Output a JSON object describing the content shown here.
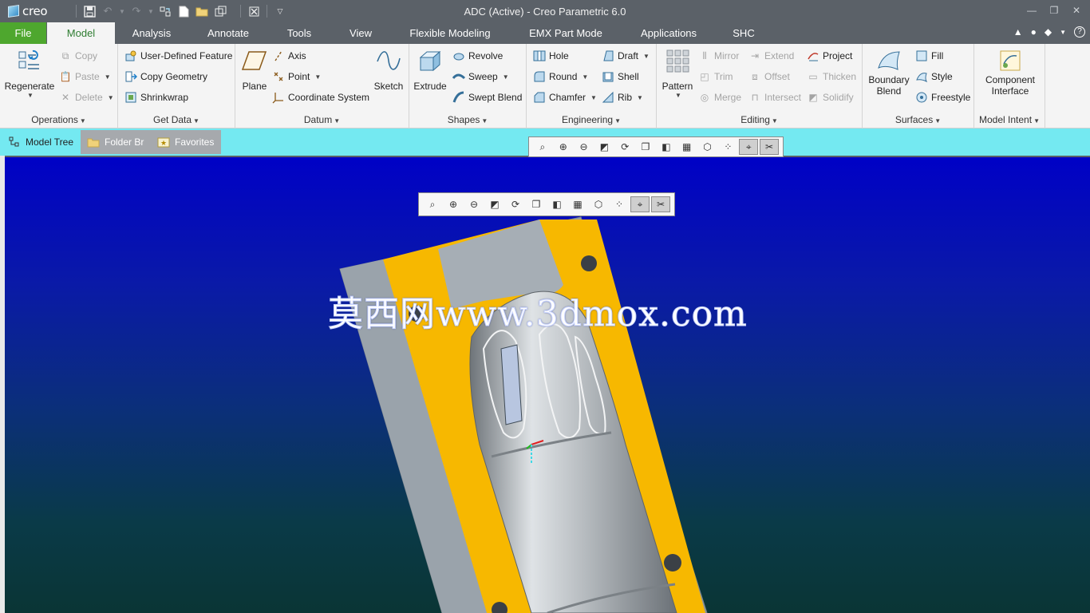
{
  "app": {
    "logo_text": "creo",
    "window_title": "ADC (Active) - Creo Parametric 6.0"
  },
  "tabs": [
    {
      "label": "File"
    },
    {
      "label": "Model"
    },
    {
      "label": "Analysis"
    },
    {
      "label": "Annotate"
    },
    {
      "label": "Tools"
    },
    {
      "label": "View"
    },
    {
      "label": "Flexible Modeling"
    },
    {
      "label": "EMX Part Mode"
    },
    {
      "label": "Applications"
    },
    {
      "label": "SHC"
    }
  ],
  "ribbon": {
    "operations": {
      "label": "Operations",
      "regenerate": "Regenerate",
      "copy": "Copy",
      "paste": "Paste",
      "delete": "Delete"
    },
    "get_data": {
      "label": "Get Data",
      "user_defined_feature": "User-Defined Feature",
      "copy_geometry": "Copy Geometry",
      "shrinkwrap": "Shrinkwrap"
    },
    "datum": {
      "label": "Datum",
      "plane": "Plane",
      "axis": "Axis",
      "point": "Point",
      "coordinate_system": "Coordinate System",
      "sketch": "Sketch"
    },
    "shapes": {
      "label": "Shapes",
      "extrude": "Extrude",
      "revolve": "Revolve",
      "sweep": "Sweep",
      "swept_blend": "Swept Blend"
    },
    "engineering": {
      "label": "Engineering",
      "hole": "Hole",
      "round": "Round",
      "chamfer": "Chamfer",
      "draft": "Draft",
      "shell": "Shell",
      "rib": "Rib"
    },
    "editing": {
      "label": "Editing",
      "pattern": "Pattern",
      "mirror": "Mirror",
      "trim": "Trim",
      "merge": "Merge",
      "extend": "Extend",
      "offset": "Offset",
      "intersect": "Intersect",
      "project": "Project",
      "thicken": "Thicken",
      "solidify": "Solidify"
    },
    "surfaces": {
      "label": "Surfaces",
      "boundary_blend_line1": "Boundary",
      "boundary_blend_line2": "Blend",
      "fill": "Fill",
      "style": "Style",
      "freestyle": "Freestyle"
    },
    "model_intent": {
      "label": "Model Intent",
      "component_interface_line1": "Component",
      "component_interface_line2": "Interface"
    }
  },
  "navigator": {
    "model_tree": "Model Tree",
    "folder_browser": "Folder Br",
    "favorites": "Favorites"
  },
  "viewport": {
    "watermark": "莫西网www.3dmox.com"
  },
  "colors": {
    "file_tab": "#4ea72e",
    "title_bar": "#5b6168",
    "navigator_bar": "#74e9f1",
    "viewport_top": "#0001c6",
    "mold_plate": "#9aa4ad",
    "mold_yellow": "#f7b800"
  }
}
